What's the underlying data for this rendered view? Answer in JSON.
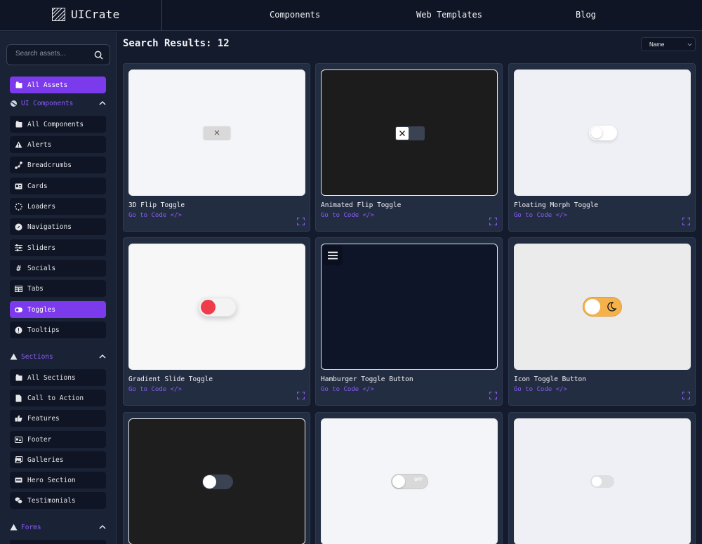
{
  "header": {
    "logo_text": "UICrate",
    "nav": [
      "Components",
      "Web Templates",
      "Blog"
    ]
  },
  "sidebar": {
    "search_placeholder": "Search assets...",
    "all_assets": "All Assets",
    "ui_components": {
      "title": "UI Components",
      "items": [
        "All Components",
        "Alerts",
        "Breadcrumbs",
        "Cards",
        "Loaders",
        "Navigations",
        "Sliders",
        "Socials",
        "Tabs",
        "Toggles",
        "Tooltips"
      ],
      "active": "Toggles"
    },
    "sections": {
      "title": "Sections",
      "items": [
        "All Sections",
        "Call to Action",
        "Features",
        "Footer",
        "Galleries",
        "Hero Section",
        "Testimonials"
      ]
    },
    "forms": {
      "title": "Forms"
    }
  },
  "main": {
    "results_title": "Search Results: 12",
    "sort_value": "Name",
    "cards": [
      {
        "name": "3D Flip Toggle",
        "link": "Go to Code </>"
      },
      {
        "name": "Animated Flip Toggle",
        "link": "Go to Code </>"
      },
      {
        "name": "Floating Morph Toggle",
        "link": "Go to Code </>"
      },
      {
        "name": "Gradient Slide Toggle",
        "link": "Go to Code </>"
      },
      {
        "name": "Hamburger Toggle Button",
        "link": "Go to Code </>"
      },
      {
        "name": "Icon Toggle Button",
        "link": "Go to Code </>"
      },
      {
        "name": "",
        "link": ""
      },
      {
        "name": "",
        "link": "",
        "toggle_text": "OFF"
      },
      {
        "name": "",
        "link": ""
      }
    ]
  },
  "colors": {
    "accent": "#7c3aed",
    "link": "#8b5cf6",
    "background": "#141b2d",
    "sidebar": "#1a2236"
  }
}
